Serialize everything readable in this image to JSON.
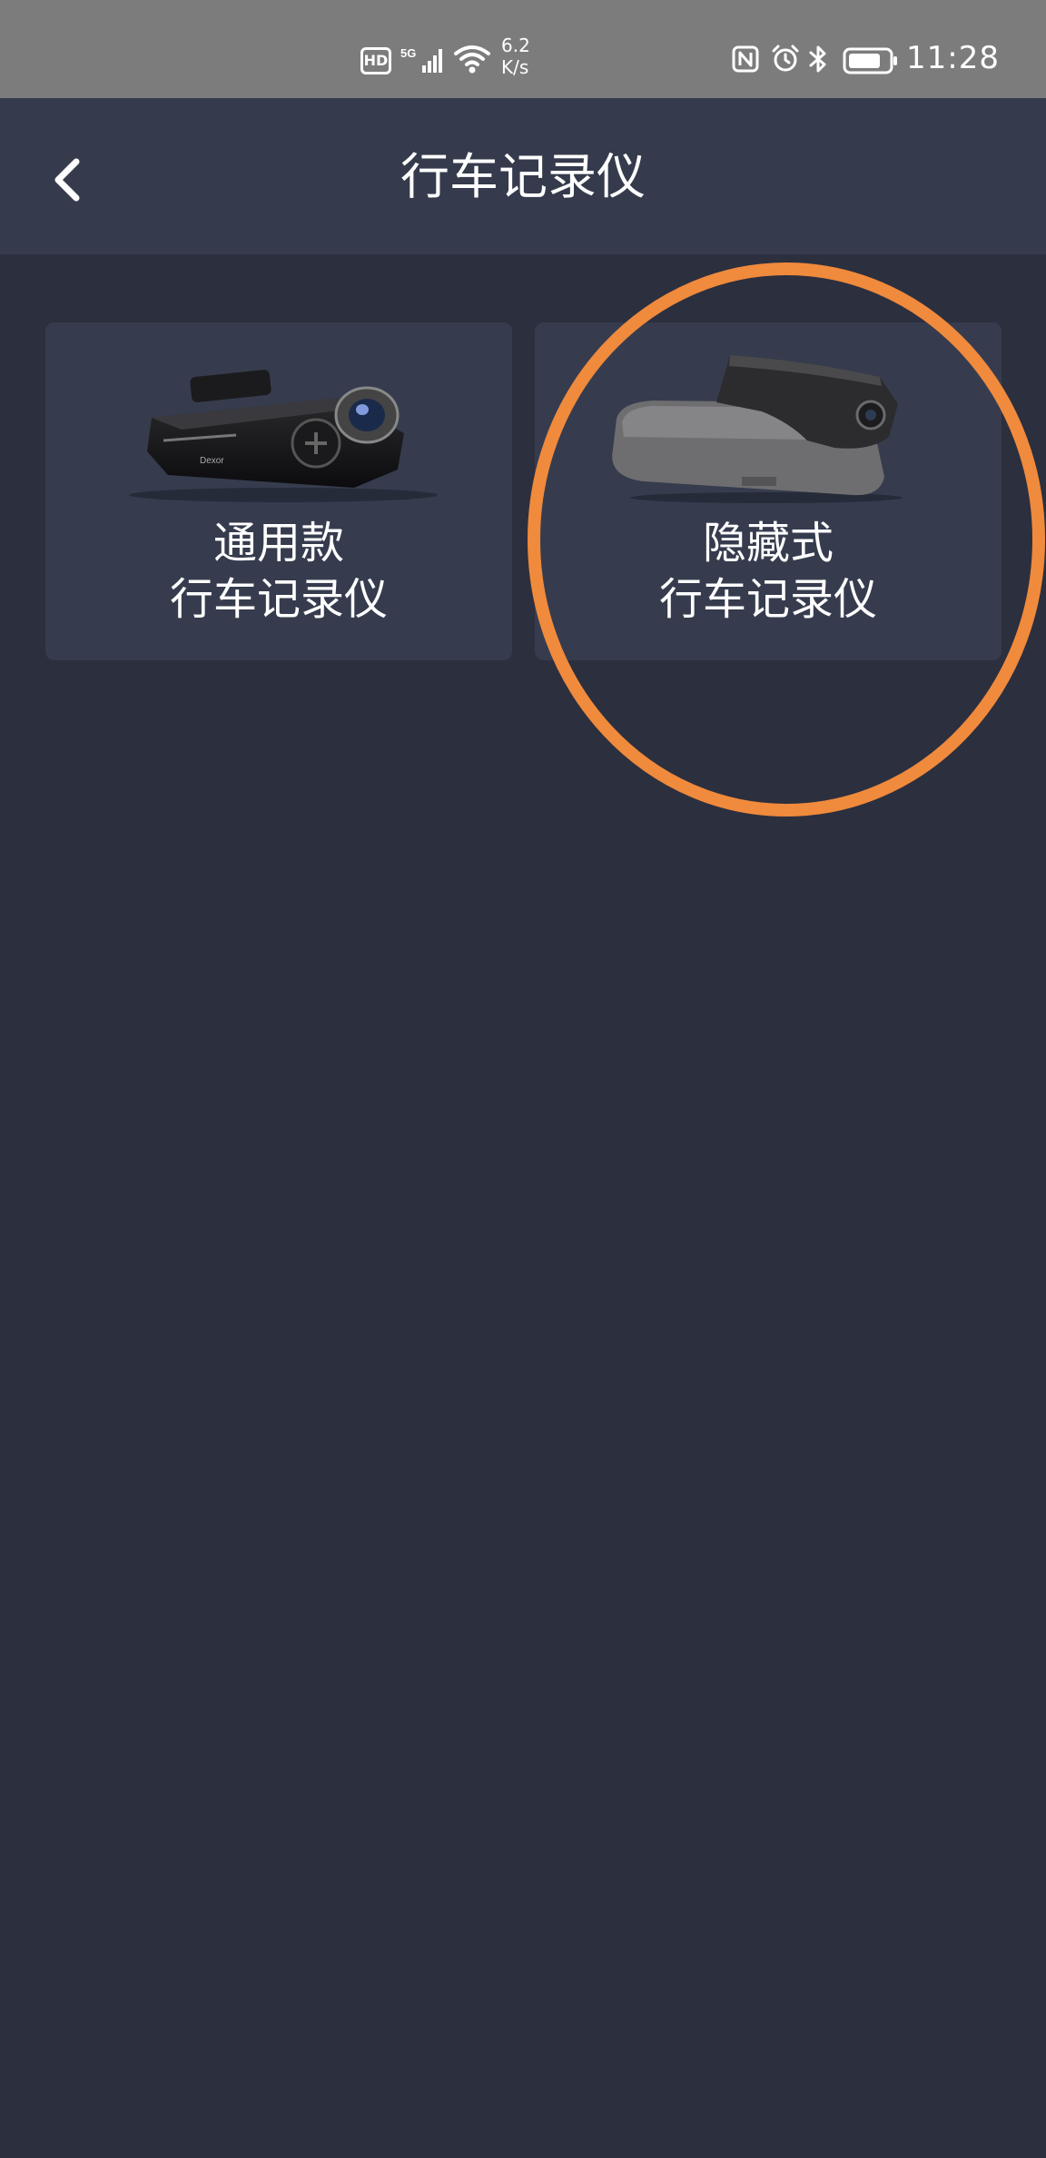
{
  "status_bar": {
    "hd_label": "HD",
    "network_label": "5G",
    "speed_value": "6.2",
    "speed_unit": "K/s",
    "time": "11:28",
    "icons": [
      "signal-icon",
      "wifi-icon",
      "nfc-icon",
      "alarm-icon",
      "bluetooth-icon",
      "battery-icon"
    ]
  },
  "header": {
    "title": "行车记录仪",
    "back_icon": "chevron-left-icon"
  },
  "cards": [
    {
      "line1": "通用款",
      "line2": "行车记录仪",
      "image": "dashcam-generic-image"
    },
    {
      "line1": "隐藏式",
      "line2": "行车记录仪",
      "image": "dashcam-hidden-mirror-image"
    }
  ],
  "colors": {
    "status_bar_bg": "#7c7c7c",
    "header_bg": "#353b4c",
    "page_bg": "#2c2f3e",
    "card_bg": "#363c4e",
    "highlight_ring": "#f08a3c",
    "text": "#ffffff"
  }
}
